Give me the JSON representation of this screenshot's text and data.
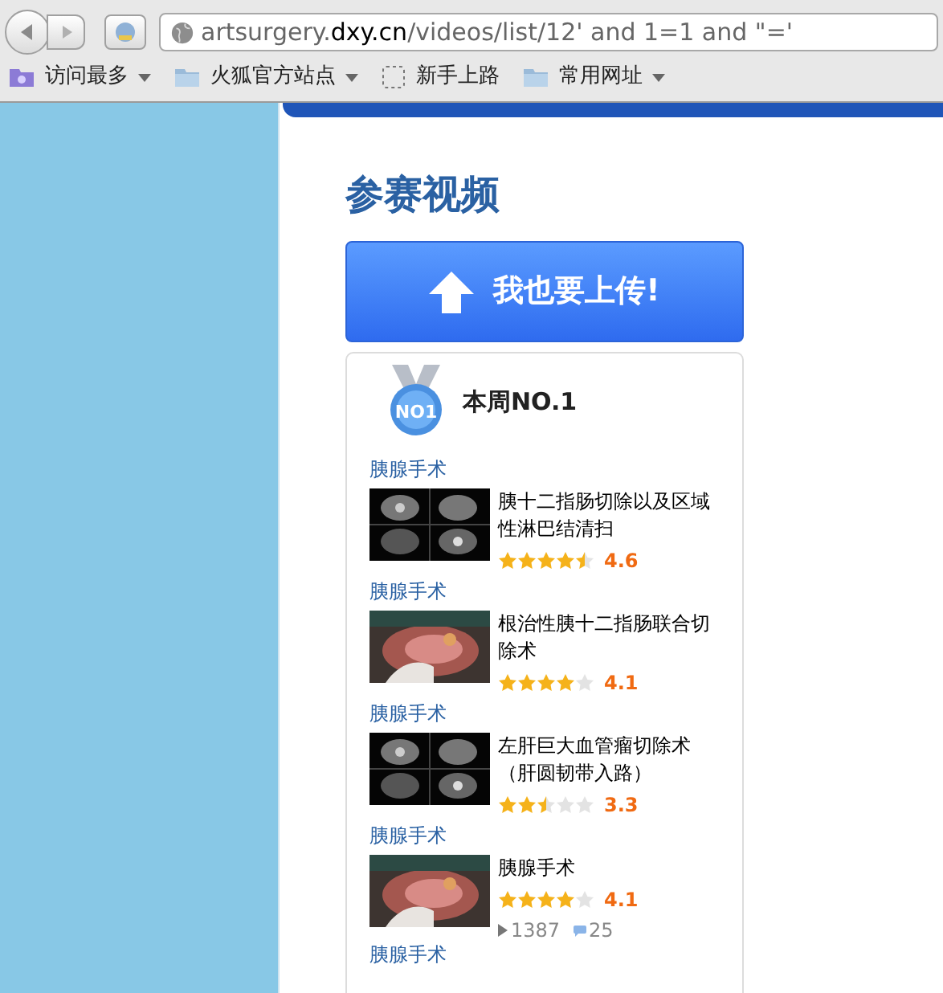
{
  "browser": {
    "url_host_prefix": "artsurgery.",
    "url_host_domain": "dxy.cn",
    "url_path": "/videos/list/12' and 1=1 and \"='",
    "bookmarks": [
      {
        "kind": "smart",
        "label": "访问最多",
        "dropdown": true
      },
      {
        "kind": "folder",
        "label": "火狐官方站点",
        "dropdown": true
      },
      {
        "kind": "page",
        "label": "新手上路",
        "dropdown": false
      },
      {
        "kind": "folder",
        "label": "常用网址",
        "dropdown": true
      }
    ]
  },
  "page": {
    "heading": "参赛视频",
    "upload_button": "我也要上传!",
    "weekly": {
      "badge": "NO1",
      "title": "本周NO.1",
      "items": [
        {
          "category": "胰腺手术",
          "title": "胰十二指肠切除以及区域性淋巴结清扫",
          "stars": 4.5,
          "score": "4.6"
        },
        {
          "category": "胰腺手术",
          "title": "根治性胰十二指肠联合切除术",
          "stars": 4,
          "score": "4.1"
        },
        {
          "category": "胰腺手术",
          "title": "左肝巨大血管瘤切除术（肝圆韧带入路）",
          "stars": 2.5,
          "score": "3.3"
        },
        {
          "category": "胰腺手术",
          "title": "胰腺手术",
          "stars": 4,
          "score": "4.1",
          "plays": "1387",
          "comments": "25"
        }
      ],
      "next_category": "胰腺手术"
    }
  }
}
